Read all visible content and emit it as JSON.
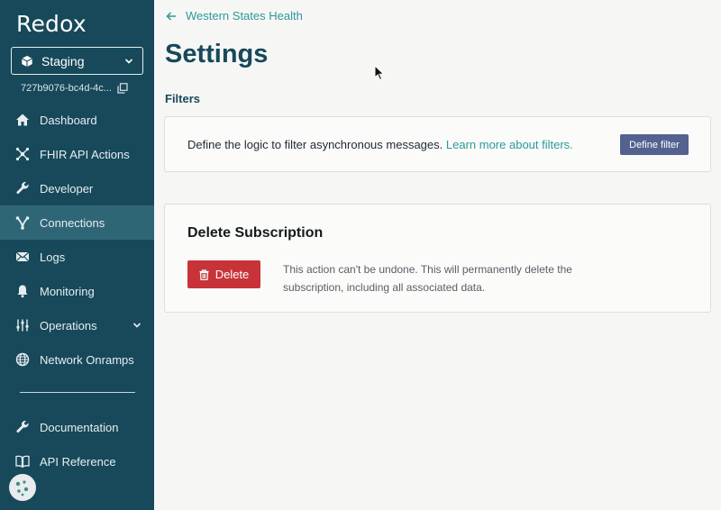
{
  "sidebar": {
    "logo": "Redox",
    "environment": {
      "label": "Staging"
    },
    "environment_id": "727b9076-bc4d-4c...",
    "items": [
      {
        "label": "Dashboard",
        "icon": "home-icon"
      },
      {
        "label": "FHIR API Actions",
        "icon": "fhir-icon"
      },
      {
        "label": "Developer",
        "icon": "wrench-icon"
      },
      {
        "label": "Connections",
        "icon": "connections-icon",
        "active": true
      },
      {
        "label": "Logs",
        "icon": "envelope-icon"
      },
      {
        "label": "Monitoring",
        "icon": "bell-icon"
      },
      {
        "label": "Operations",
        "icon": "sliders-icon"
      },
      {
        "label": "Network Onramps",
        "icon": "globe-icon"
      }
    ],
    "bottom_items": [
      {
        "label": "Documentation",
        "icon": "wrench-icon"
      },
      {
        "label": "API Reference",
        "icon": "book-icon"
      }
    ]
  },
  "main": {
    "breadcrumb": "Western States Health",
    "title": "Settings",
    "filters": {
      "section_label": "Filters",
      "description": "Define the logic to filter asynchronous messages.",
      "learn_more": "Learn more about filters.",
      "button": "Define filter"
    },
    "delete_subscription": {
      "heading": "Delete Subscription",
      "button": "Delete",
      "warning": "This action can't be undone. This will permanently delete the subscription, including all associated data."
    }
  },
  "colors": {
    "sidebar_bg": "#17495a",
    "sidebar_active": "#2f6676",
    "accent_teal": "#2a9a9a",
    "define_button": "#53628f",
    "delete_button": "#c83339"
  }
}
